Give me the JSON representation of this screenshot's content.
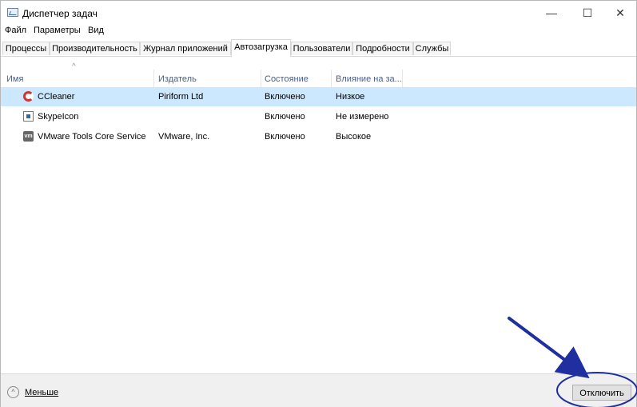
{
  "window": {
    "title": "Диспетчер задач"
  },
  "titlebar_buttons": {
    "minimize": "—",
    "maximize": "☐",
    "close": "✕"
  },
  "menu": [
    "Файл",
    "Параметры",
    "Вид"
  ],
  "tabs": [
    {
      "label": "Процессы",
      "active": false
    },
    {
      "label": "Производительность",
      "active": false
    },
    {
      "label": "Журнал приложений",
      "active": false
    },
    {
      "label": "Автозагрузка",
      "active": true
    },
    {
      "label": "Пользователи",
      "active": false
    },
    {
      "label": "Подробности",
      "active": false
    },
    {
      "label": "Службы",
      "active": false
    }
  ],
  "columns": [
    "Имя",
    "Издатель",
    "Состояние",
    "Влияние на за..."
  ],
  "rows": [
    {
      "icon": "ccleaner-icon",
      "name": "CCleaner",
      "publisher": "Piriform Ltd",
      "status": "Включено",
      "impact": "Низкое",
      "selected": true
    },
    {
      "icon": "skype-icon",
      "name": "SkypeIcon",
      "publisher": "",
      "status": "Включено",
      "impact": "Не измерено",
      "selected": false
    },
    {
      "icon": "vmware-icon",
      "name": "VMware Tools Core Service",
      "publisher": "VMware, Inc.",
      "status": "Включено",
      "impact": "Высокое",
      "selected": false
    }
  ],
  "footer": {
    "less_label": "Меньше",
    "disable_button": "Отключить"
  },
  "icons": {
    "vmware_text": "vm"
  },
  "colors": {
    "selected_row": "#cce8ff",
    "annotation": "#1f2f9f"
  }
}
